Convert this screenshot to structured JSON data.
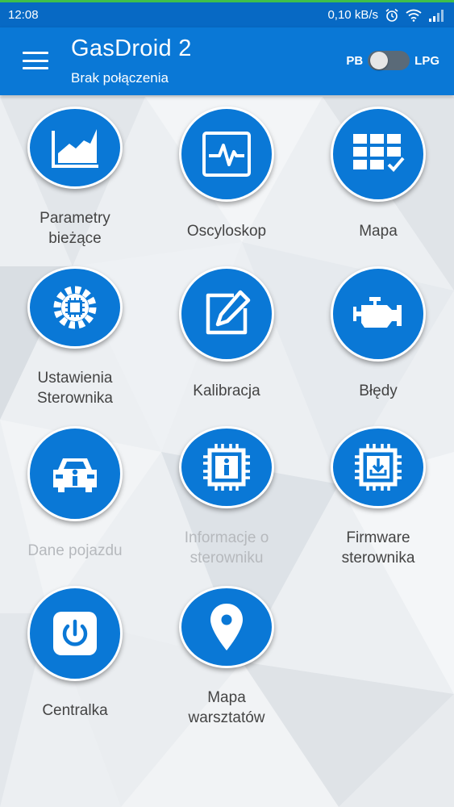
{
  "status_bar": {
    "time": "12:08",
    "network_speed": "0,10 kB/s",
    "icons": [
      "alarm-icon",
      "wifi-icon",
      "signal-icon"
    ]
  },
  "app_bar": {
    "title": "GasDroid 2",
    "subtitle": "Brak połączenia",
    "menu_icon": "hamburger-menu-icon",
    "fuel_toggle": {
      "left_label": "PB",
      "right_label": "LPG",
      "selected": "PB"
    }
  },
  "colors": {
    "accent": "#0a78d6",
    "status_bar": "#0769c4",
    "label_text": "#444444",
    "disabled_text": "#b6b9bd"
  },
  "menu": [
    {
      "label": "Parametry\nbieżące",
      "icon": "chart-area-icon",
      "enabled": true
    },
    {
      "label": "Oscyloskop",
      "icon": "oscilloscope-icon",
      "enabled": true
    },
    {
      "label": "Mapa",
      "icon": "map-table-icon",
      "enabled": true
    },
    {
      "label": "Ustawienia\nSterownika",
      "icon": "chip-gear-icon",
      "enabled": true
    },
    {
      "label": "Kalibracja",
      "icon": "edit-pencil-icon",
      "enabled": true
    },
    {
      "label": "Błędy",
      "icon": "engine-icon",
      "enabled": true
    },
    {
      "label": "Dane pojazdu",
      "icon": "car-info-icon",
      "enabled": false
    },
    {
      "label": "Informacje o\nsterowniku",
      "icon": "chip-info-icon",
      "enabled": false
    },
    {
      "label": "Firmware\nsterownika",
      "icon": "chip-download-icon",
      "enabled": true
    },
    {
      "label": "Centralka",
      "icon": "power-icon",
      "enabled": true
    },
    {
      "label": "Mapa\nwarsztatów",
      "icon": "location-pin-icon",
      "enabled": true
    }
  ]
}
